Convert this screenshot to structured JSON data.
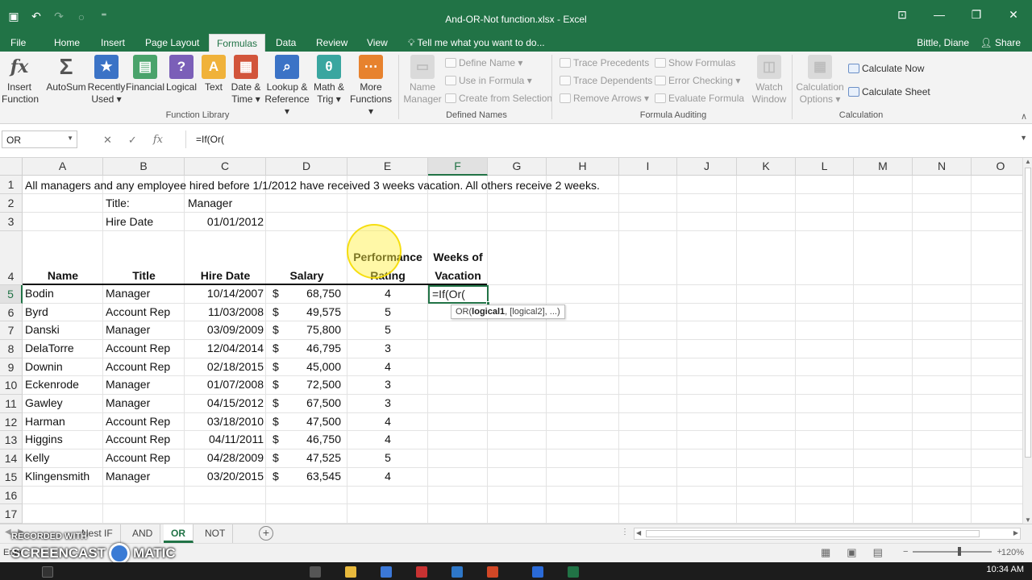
{
  "app": {
    "window_title": "And-OR-Not function.xlsx - Excel",
    "user": "Bittle, Diane",
    "share_label": "Share",
    "tell_me": "Tell me what you want to do..."
  },
  "ribbon_tabs": [
    "File",
    "Home",
    "Insert",
    "Page Layout",
    "Formulas",
    "Data",
    "Review",
    "View"
  ],
  "active_tab": "Formulas",
  "function_library": {
    "buttons": [
      {
        "line1": "Insert",
        "line2": "Function",
        "icon": "fx-icon"
      },
      {
        "line1": "AutoSum",
        "line2": "",
        "icon": "sigma-icon"
      },
      {
        "line1": "Recently",
        "line2": "Used",
        "icon": "star-book-icon"
      },
      {
        "line1": "Financial",
        "line2": "",
        "icon": "financial-book-icon"
      },
      {
        "line1": "Logical",
        "line2": "",
        "icon": "question-book-icon"
      },
      {
        "line1": "Text",
        "line2": "",
        "icon": "text-book-icon"
      },
      {
        "line1": "Date &",
        "line2": "Time",
        "icon": "calendar-book-icon"
      },
      {
        "line1": "Lookup &",
        "line2": "Reference",
        "icon": "magnifier-book-icon"
      },
      {
        "line1": "Math &",
        "line2": "Trig",
        "icon": "theta-book-icon"
      },
      {
        "line1": "More",
        "line2": "Functions",
        "icon": "more-book-icon"
      }
    ],
    "label": "Function Library"
  },
  "defined_names": {
    "name_manager_line1": "Name",
    "name_manager_line2": "Manager",
    "items": [
      "Define Name",
      "Use in Formula",
      "Create from Selection"
    ],
    "label": "Defined Names"
  },
  "formula_auditing": {
    "left": [
      "Trace Precedents",
      "Trace Dependents",
      "Remove Arrows"
    ],
    "right": [
      "Show Formulas",
      "Error Checking",
      "Evaluate Formula"
    ],
    "watch_line1": "Watch",
    "watch_line2": "Window",
    "label": "Formula Auditing"
  },
  "calculation": {
    "options_line1": "Calculation",
    "options_line2": "Options",
    "calc_now": "Calculate Now",
    "calc_sheet": "Calculate Sheet",
    "label": "Calculation"
  },
  "formula_bar": {
    "name_box": "OR",
    "formula": "=If(Or("
  },
  "columns": [
    "A",
    "B",
    "C",
    "D",
    "E",
    "F",
    "G",
    "H",
    "I",
    "J",
    "K",
    "L",
    "M",
    "N",
    "O"
  ],
  "rows": [
    "1",
    "2",
    "3",
    "4",
    "5",
    "6",
    "7",
    "8",
    "9",
    "10",
    "11",
    "12",
    "13",
    "14",
    "15",
    "16",
    "17"
  ],
  "sheet": {
    "instructions": "All managers and any employee hired before 1/1/2012 have received 3 weeks vacation. All others receive 2 weeks.",
    "title_label": "Title:",
    "title_value": "Manager",
    "hire_label": "Hire Date",
    "hire_value": "01/01/2012",
    "headers": {
      "name": "Name",
      "title": "Title",
      "hire_date": "Hire Date",
      "salary": "Salary",
      "rating_1": "Performance",
      "rating_2": "Rating",
      "weeks_1": "Weeks of",
      "weeks_2": "Vacation"
    },
    "employees": [
      {
        "name": "Bodin",
        "title": "Manager",
        "hire": "10/14/2007",
        "salary": "68,750",
        "rating": "4"
      },
      {
        "name": "Byrd",
        "title": "Account Rep",
        "hire": "11/03/2008",
        "salary": "49,575",
        "rating": "5"
      },
      {
        "name": "Danski",
        "title": "Manager",
        "hire": "03/09/2009",
        "salary": "75,800",
        "rating": "5"
      },
      {
        "name": "DelaTorre",
        "title": "Account Rep",
        "hire": "12/04/2014",
        "salary": "46,795",
        "rating": "3"
      },
      {
        "name": "Downin",
        "title": "Account Rep",
        "hire": "02/18/2015",
        "salary": "45,000",
        "rating": "4"
      },
      {
        "name": "Eckenrode",
        "title": "Manager",
        "hire": "01/07/2008",
        "salary": "72,500",
        "rating": "3"
      },
      {
        "name": "Gawley",
        "title": "Manager",
        "hire": "04/15/2012",
        "salary": "67,500",
        "rating": "3"
      },
      {
        "name": "Harman",
        "title": "Account Rep",
        "hire": "03/18/2010",
        "salary": "47,500",
        "rating": "4"
      },
      {
        "name": "Higgins",
        "title": "Account Rep",
        "hire": "04/11/2011",
        "salary": "46,750",
        "rating": "4"
      },
      {
        "name": "Kelly",
        "title": "Account Rep",
        "hire": "04/28/2009",
        "salary": "47,525",
        "rating": "5"
      },
      {
        "name": "Klingensmith",
        "title": "Manager",
        "hire": "03/20/2015",
        "salary": "63,545",
        "rating": "4"
      }
    ],
    "currency_symbol": "$",
    "active_cell_text": "=If(Or(",
    "tooltip_fn": "OR(",
    "tooltip_arg": "logical1",
    "tooltip_rest": ", [logical2], ...)"
  },
  "sheet_tabs": [
    "Nest IF",
    "AND",
    "OR",
    "NOT"
  ],
  "active_sheet": "OR",
  "status": {
    "mode": "Enter",
    "zoom": "120%"
  },
  "watermark": {
    "line1": "RECORDED WITH",
    "line2a": "SCREENCAST",
    "line2b": "MATIC"
  },
  "taskbar": {
    "time": "10:34 AM"
  },
  "colors": {
    "excel_green": "#217346",
    "ribbon_bg": "#f3f3f3"
  }
}
